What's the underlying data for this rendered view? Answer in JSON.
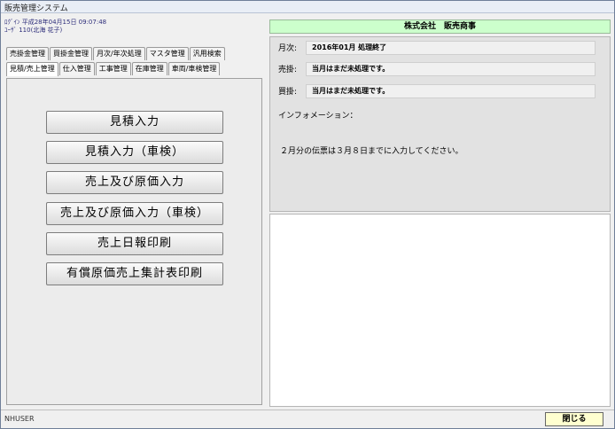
{
  "window": {
    "title": "販売管理システム"
  },
  "login": {
    "line1": "ﾛｸﾞｲﾝ 平成28年04月15日 09:07:48",
    "line2": "ﾕｰｻﾞ 110(北海 花子)"
  },
  "tabs_top": [
    {
      "label": "売掛金管理"
    },
    {
      "label": "買掛金管理"
    },
    {
      "label": "月次/年次処理"
    },
    {
      "label": "マスタ管理"
    },
    {
      "label": "汎用検索"
    }
  ],
  "tabs_bottom": [
    {
      "label": "見積/売上管理"
    },
    {
      "label": "仕入管理"
    },
    {
      "label": "工事管理"
    },
    {
      "label": "在庫管理"
    },
    {
      "label": "車両/車検管理"
    }
  ],
  "menu_buttons": [
    {
      "label": "見積入力"
    },
    {
      "label": "見積入力（車検）"
    },
    {
      "label": "売上及び原価入力"
    },
    {
      "label": "売上及び原価入力（車検）"
    },
    {
      "label": "売上日報印刷"
    },
    {
      "label": "有償原価売上集計表印刷"
    }
  ],
  "company": {
    "name": "株式会社　販売商事"
  },
  "info": {
    "monthly_label": "月次:",
    "monthly_value": "2016年01月 処理終了",
    "sales_label": "売掛:",
    "sales_value": "当月はまだ未処理です。",
    "purchase_label": "買掛:",
    "purchase_value": "当月はまだ未処理です。",
    "info_title": "インフォメーション：",
    "info_message": "２月分の伝票は３月８日までに入力してください。"
  },
  "status": {
    "user": "NHUSER",
    "close_label": "閉じる"
  },
  "colors": {
    "company_bg": "#ccffcc",
    "close_bg": "#ffffd0"
  }
}
